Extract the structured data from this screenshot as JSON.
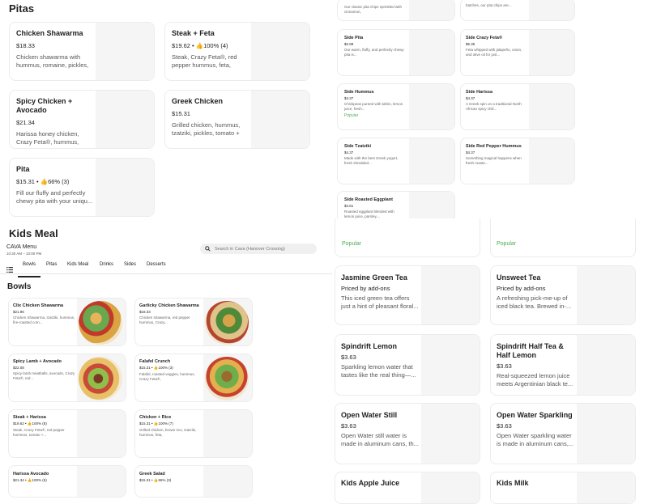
{
  "top_section": {
    "heading": "Pitas",
    "cards": [
      {
        "title": "Chicken Shawarma",
        "price": "$18.33",
        "desc": "Chicken shawarma with hummus, romaine, pickles,"
      },
      {
        "title": "Steak + Feta",
        "price": "$19.62 • ",
        "rating": "100% (4)",
        "desc": "Steak, Crazy Feta®, red pepper hummus, feta,"
      },
      {
        "title": "Spicy Chicken + Avocado",
        "price": "$21.34",
        "desc": "Harissa honey chicken, Crazy Feta®, hummus,"
      },
      {
        "title": "Greek Chicken",
        "price": "$15.31",
        "desc": "Grilled chicken, hummus, tzatziki, pickles, tomato +"
      },
      {
        "title": "Pita",
        "price": "$15.31 • ",
        "rating": "66% (3)",
        "desc": "Fill our fluffy and perfectly chewy pita with your uniqu..."
      }
    ]
  },
  "kids_meal_heading": "Kids Meal",
  "store": {
    "name": "CAVA Menu",
    "hours": "10:30 AM – 10:00 PM"
  },
  "search": {
    "placeholder": "Search in Cava (Hanover Crossing)"
  },
  "tabs": [
    "Bowls",
    "Pitas",
    "Kids Meal",
    "Drinks",
    "Sides",
    "Desserts"
  ],
  "bowls": {
    "heading": "Bowls",
    "items": [
      {
        "title": "Clix Chicken Shawarma",
        "price": "$21.96",
        "desc": "Chicken Shawarma, tzatziki, hummus, fire-roasted corn..."
      },
      {
        "title": "Garlicky Chicken Shawarma",
        "price": "$18.33",
        "desc": "Chicken shawarma, red pepper hummus, Crazy..."
      },
      {
        "title": "Spicy Lamb + Avocado",
        "price": "$22.08",
        "desc": "Spicy lamb meatballs, avocado, Crazy Feta®, red..."
      },
      {
        "title": "Falafel Crunch",
        "price": "$15.31 • ",
        "rating": "100% (3)",
        "desc": "Falafel, roasted veggies, hummus, Crazy Feta®,"
      },
      {
        "title": "Steak + Harissa",
        "price": "$19.62 • ",
        "rating": "100% (8)",
        "desc": "Steak, Crazy Feta®, red pepper hummus, tomato +..."
      },
      {
        "title": "Chicken + Rice",
        "price": "$15.31 • ",
        "rating": "100% (7)",
        "desc": "Grilled chicken, brown rice, tzatziki, hummus, feta,"
      },
      {
        "title": "Harissa Avocado",
        "price": "$21.34 • ",
        "rating": "100% (5)"
      },
      {
        "title": "Greek Salad",
        "price": "$15.31 • ",
        "rating": "66% (3)"
      }
    ]
  },
  "sides": {
    "top_fragments": [
      "Our classic pita chips sprinkled with cinnamon,",
      "batches, our pita chips are..."
    ],
    "items": [
      {
        "title": "Side Pita",
        "price": "$2.89",
        "desc": "Our warm, fluffy, and perfectly chewy pita is..."
      },
      {
        "title": "Side Crazy Feta®",
        "price": "$5.35",
        "desc": "Feta whipped with jalapeño, onion, and olive oil for just..."
      },
      {
        "title": "Side Hummus",
        "price": "$4.37",
        "desc": "Chickpeas pureed with tahini, lemon juice, fresh...",
        "popular": "Popular"
      },
      {
        "title": "Side Harissa",
        "price": "$4.37",
        "desc": "A Greek spin on a traditional North African spicy chili..."
      },
      {
        "title": "Side Tzatziki",
        "price": "$4.37",
        "desc": "Made with the best Greek yogurt, fresh shredded..."
      },
      {
        "title": "Side Red Pepper Hummus",
        "price": "$4.37",
        "desc": "Something magical happens when fresh roaste..."
      },
      {
        "title": "Side Roasted Eggplant",
        "price": "$4.61",
        "desc": "Roasted eggplant blended with lemon juice, parsley,..."
      }
    ]
  },
  "drinks": {
    "popular_labels": [
      "Popular",
      "Popular"
    ],
    "items": [
      {
        "title": "Jasmine Green Tea",
        "price": "Priced by add-ons",
        "desc": "This iced green tea offers just a hint of pleasant floral..."
      },
      {
        "title": "Unsweet Tea",
        "price": "Priced by add-ons",
        "desc": "A refreshing pick-me-up of iced black tea. Brewed in-..."
      },
      {
        "title": "Spindrift Lemon",
        "price": "$3.63",
        "desc": "Sparkling lemon water that tastes like the real thing—..."
      },
      {
        "title": "Spindrift Half Tea & Half Lemon",
        "price": "$3.63",
        "desc": "Real-squeezed lemon juice meets Argentinian black te..."
      },
      {
        "title": "Open Water Still",
        "price": "$3.63",
        "desc": "Open Water still water is made in aluminum cans, th..."
      },
      {
        "title": "Open Water Sparkling",
        "price": "$3.63",
        "desc": "Open Water sparkling water is made in aluminum cans,..."
      },
      {
        "title": "Kids Apple Juice"
      },
      {
        "title": "Kids Milk"
      }
    ]
  },
  "colors": {
    "popular": "#4caf50",
    "text": "#1f1f1f",
    "muted": "#555555"
  }
}
